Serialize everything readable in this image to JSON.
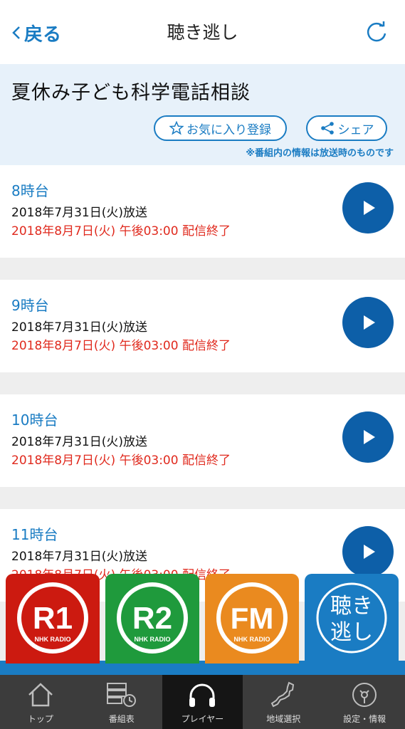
{
  "header": {
    "back_label": "戻る",
    "title": "聴き逃し"
  },
  "program": {
    "title": "夏休み子ども科学電話相談",
    "favorite_label": "お気に入り登録",
    "share_label": "シェア",
    "note": "※番組内の情報は放送時のものです"
  },
  "episodes": [
    {
      "hour": "8時台",
      "aired": "2018年7月31日(火)放送",
      "expire": "2018年8月7日(火) 午後03:00 配信終了"
    },
    {
      "hour": "9時台",
      "aired": "2018年7月31日(火)放送",
      "expire": "2018年8月7日(火) 午後03:00 配信終了"
    },
    {
      "hour": "10時台",
      "aired": "2018年7月31日(火)放送",
      "expire": "2018年8月7日(火) 午後03:00 配信終了"
    },
    {
      "hour": "11時台",
      "aired": "2018年7月31日(火)放送",
      "expire": "2018年8月7日(火) 午後03:00 配信終了"
    }
  ],
  "stations": {
    "r1": {
      "label": "R1",
      "sub": "NHK RADIO",
      "color": "#cc1a10"
    },
    "r2": {
      "label": "R2",
      "sub": "NHK RADIO",
      "color": "#1f9a3c"
    },
    "fm": {
      "label": "FM",
      "sub": "NHK RADIO",
      "color": "#ea8a1f"
    },
    "kiki": {
      "label_line1": "聴き",
      "label_line2": "逃し",
      "color": "#1a7cc3"
    }
  },
  "tabs": [
    {
      "label": "トップ",
      "icon": "home-icon"
    },
    {
      "label": "番組表",
      "icon": "schedule-icon"
    },
    {
      "label": "プレイヤー",
      "icon": "headphones-icon",
      "active": true
    },
    {
      "label": "地域選択",
      "icon": "japan-map-icon"
    },
    {
      "label": "設定・情報",
      "icon": "settings-icon"
    }
  ],
  "colors": {
    "accent": "#1a7cc3",
    "play_button": "#0d5fa8",
    "expire_text": "#e02a1e",
    "banner_bg": "#e7f1fa",
    "tabbar_bg": "#3c3c3c"
  }
}
